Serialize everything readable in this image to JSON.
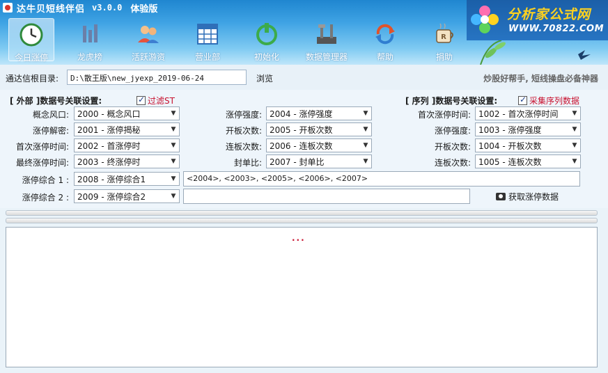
{
  "window": {
    "title": "达牛贝短线伴侣",
    "version": "v3.0.0",
    "edition": "体验版"
  },
  "toolbar": [
    {
      "label": "今日涨停",
      "icon": "clock-icon",
      "active": true
    },
    {
      "label": "龙虎榜",
      "icon": "bars-icon",
      "active": false
    },
    {
      "label": "活跃游资",
      "icon": "users-icon",
      "active": false
    },
    {
      "label": "营业部",
      "icon": "grid-icon",
      "active": false
    },
    {
      "label": "初始化",
      "icon": "power-icon",
      "active": false
    },
    {
      "label": "数据管理器",
      "icon": "tools-icon",
      "active": false
    },
    {
      "label": "帮助",
      "icon": "help-refresh-icon",
      "active": false
    },
    {
      "label": "捐助",
      "icon": "coffee-icon",
      "active": false
    }
  ],
  "brand": {
    "name": "分析家公式网",
    "url": "WWW.70822.COM"
  },
  "path": {
    "label": "通达信根目录:",
    "value": "D:\\散王版\\new_jyexp_2019-06-24",
    "browse_label": "浏览",
    "slogan": "炒股好帮手, 短线操盘必备神器"
  },
  "external": {
    "title": "[ 外部 ]数据号关联设置:",
    "filter_st_label": "过滤ST",
    "filter_st_checked": true,
    "fields": [
      {
        "label": "概念风口:",
        "value": "2000  -   概念风口"
      },
      {
        "label": "涨停解密:",
        "value": "2001  -   涨停揭秘"
      },
      {
        "label": "首次涨停时间:",
        "value": "2002  -   首涨停时"
      },
      {
        "label": "最终涨停时间:",
        "value": "2003  -   终涨停时"
      }
    ],
    "fields2": [
      {
        "label": "涨停强度:",
        "value": "2004  -   涨停强度"
      },
      {
        "label": "开板次数:",
        "value": "2005  -   开板次数"
      },
      {
        "label": "连板次数:",
        "value": "2006  -   连板次数"
      },
      {
        "label": "封单比:",
        "value": "2007  -   封单比"
      }
    ],
    "combo": [
      {
        "label": "涨停综合 1 :",
        "value": "2008  -   涨停综合1",
        "text": "<2004>, <2003>, <2005>, <2006>, <2007>"
      },
      {
        "label": "涨停综合 2 :",
        "value": "2009  -   涨停综合2",
        "text": ""
      }
    ]
  },
  "sequence": {
    "title": "[ 序列 ]数据号关联设置:",
    "collect_label": "采集序列数据",
    "collect_checked": true,
    "fields": [
      {
        "label": "首次涨停时间:",
        "value": "1002  -   首次涨停时间"
      },
      {
        "label": "涨停强度:",
        "value": "1003  -   涨停强度"
      },
      {
        "label": "开板次数:",
        "value": "1004  -   开板次数"
      },
      {
        "label": "连板次数:",
        "value": "1005  -   连板次数"
      }
    ]
  },
  "fetch_label": "获取涨停数据",
  "log_text": "..."
}
